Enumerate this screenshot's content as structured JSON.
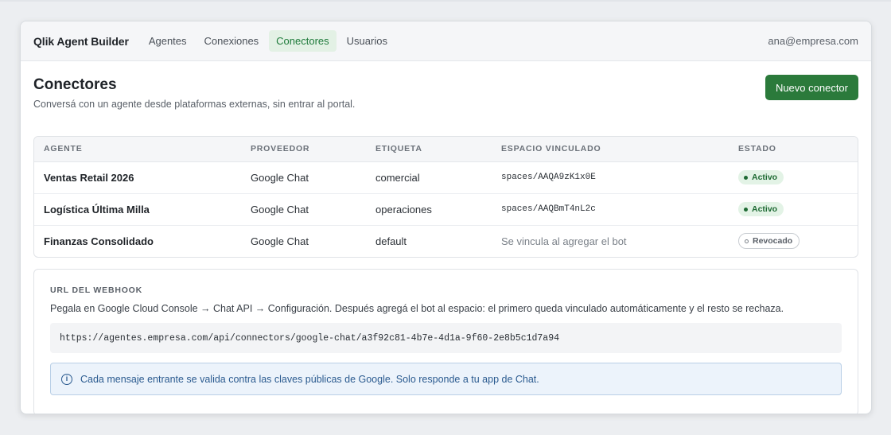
{
  "app": {
    "brand": "Qlik Agent Builder",
    "user_email": "ana@empresa.com"
  },
  "nav": {
    "items": [
      {
        "label": "Agentes",
        "active": false
      },
      {
        "label": "Conexiones",
        "active": false
      },
      {
        "label": "Conectores",
        "active": true
      },
      {
        "label": "Usuarios",
        "active": false
      }
    ]
  },
  "page": {
    "title": "Conectores",
    "subtitle": "Conversá con un agente desde plataformas externas, sin entrar al portal.",
    "new_button_label": "Nuevo conector"
  },
  "table": {
    "columns": [
      "AGENTE",
      "PROVEEDOR",
      "ETIQUETA",
      "ESPACIO VINCULADO",
      "ESTADO"
    ],
    "rows": [
      {
        "agent": "Ventas Retail 2026",
        "provider": "Google Chat",
        "label": "comercial",
        "space": "spaces/AAQA9zK1x0E",
        "space_muted": false,
        "status": "Activo",
        "status_kind": "active"
      },
      {
        "agent": "Logística Última Milla",
        "provider": "Google Chat",
        "label": "operaciones",
        "space": "spaces/AAQBmT4nL2c",
        "space_muted": false,
        "status": "Activo",
        "status_kind": "active"
      },
      {
        "agent": "Finanzas Consolidado",
        "provider": "Google Chat",
        "label": "default",
        "space": "Se vincula al agregar el bot",
        "space_muted": true,
        "status": "Revocado",
        "status_kind": "revoked"
      }
    ]
  },
  "webhook": {
    "section_label": "URL DEL WEBHOOK",
    "instructions": "Pegala en Google Cloud Console → Chat API → Configuración. Después agregá el bot al espacio: el primero queda vinculado automáticamente y el resto se rechaza.",
    "url": "https://agentes.empresa.com/api/connectors/google-chat/a3f92c81-4b7e-4d1a-9f60-2e8b5c1d7a94",
    "info_icon_glyph": "i",
    "info_text": "Cada mensaje entrante se valida contra las claves públicas de Google. Solo responde a tu app de Chat."
  },
  "colors": {
    "accent": "#2b7a3b",
    "nav_active_bg": "#e3f1e5",
    "info_bg": "#ecf3fb",
    "info_text": "#2a5a8f"
  }
}
